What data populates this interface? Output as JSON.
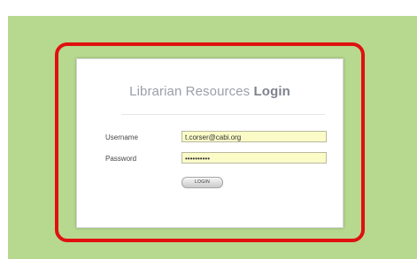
{
  "title": {
    "regular": "Librarian Resources",
    "bold": "Login"
  },
  "form": {
    "username_label": "Username",
    "username_value": "t.corser@cabi.org",
    "password_label": "Password",
    "password_value": "••••••••••",
    "login_label": "LOGIN"
  },
  "colors": {
    "background_green": "#b7d88f",
    "highlight_red": "#e01010",
    "input_yellow": "#fbfbc8"
  }
}
